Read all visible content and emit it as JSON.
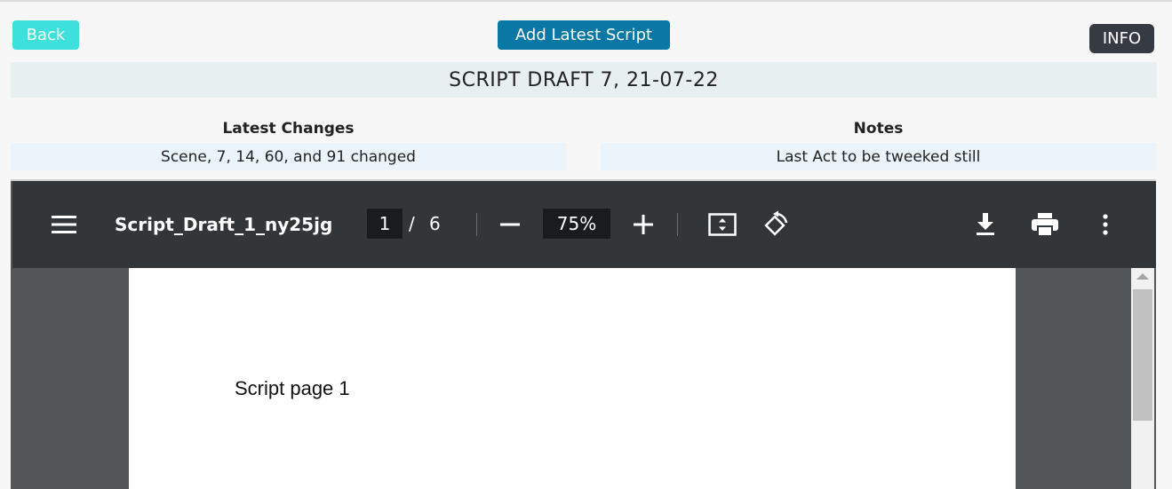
{
  "header": {
    "back_label": "Back",
    "add_label": "Add Latest Script",
    "info_label": "INFO",
    "title": "SCRIPT DRAFT 7, 21-07-22"
  },
  "changes": {
    "label": "Latest Changes",
    "value": "Scene, 7, 14, 60, and 91 changed"
  },
  "notes": {
    "label": "Notes",
    "value": "Last Act to be tweeked still"
  },
  "viewer": {
    "doc_title": "Script_Draft_1_ny25jg",
    "page_current": "1",
    "page_separator": "/",
    "page_total": "6",
    "zoom": "75%",
    "page_text": "Script page 1",
    "icons": [
      "menu-icon",
      "zoom-out-icon",
      "zoom-in-icon",
      "fit-page-icon",
      "rotate-icon",
      "download-icon",
      "print-icon",
      "more-vert-icon"
    ]
  },
  "colors": {
    "back": "#3ee0dc",
    "add": "#0a78a4",
    "info": "#363b43",
    "toolbar": "#323639",
    "viewer_bg": "#525659"
  }
}
